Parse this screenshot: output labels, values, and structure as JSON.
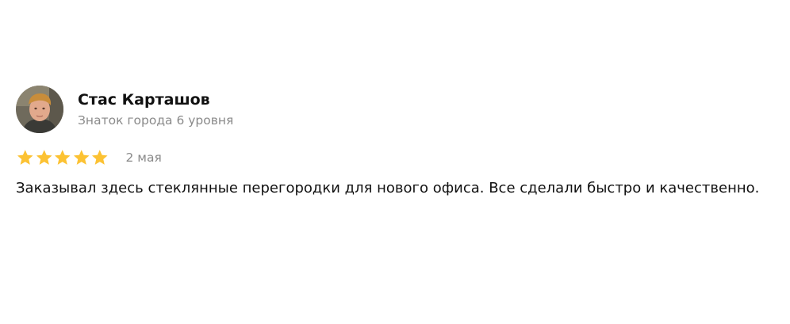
{
  "review": {
    "author_name": "Стас Карташов",
    "author_level": "Знаток города 6 уровня",
    "rating": 5,
    "rating_max": 5,
    "date": "2 мая",
    "text": "Заказывал здесь стеклянные перегородки для нового офиса. Все сделали быстро и качественно."
  },
  "icons": {
    "star": "star-icon",
    "avatar": "user-photo"
  },
  "colors": {
    "star": "#fcc233",
    "author_name": "#111111",
    "secondary_text": "#8a8a8a",
    "body_text": "#111111"
  }
}
